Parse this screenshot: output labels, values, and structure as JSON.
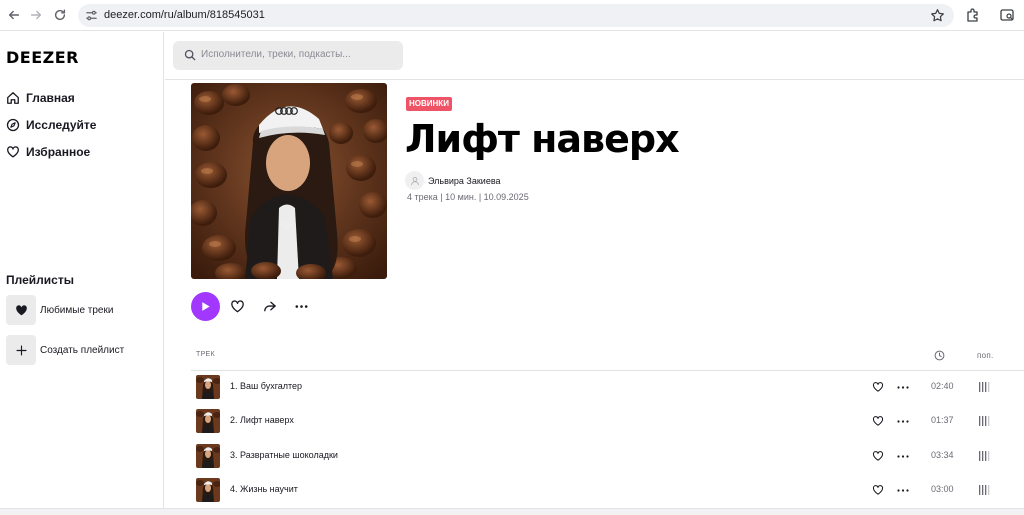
{
  "browser": {
    "url": "deezer.com/ru/album/818545031"
  },
  "sidebar": {
    "logo": "DEEZER",
    "nav": [
      {
        "label": "Главная",
        "icon": "home-icon"
      },
      {
        "label": "Исследуйте",
        "icon": "compass-icon"
      },
      {
        "label": "Избранное",
        "icon": "heart-icon"
      }
    ],
    "playlists_title": "Плейлисты",
    "playlists": [
      {
        "label": "Любимые треки",
        "icon": "heart-filled-icon"
      },
      {
        "label": "Создать плейлист",
        "icon": "plus-icon"
      }
    ]
  },
  "search": {
    "placeholder": "Исполнители, треки, подкасты..."
  },
  "album": {
    "badge": "НОВИНКИ",
    "title": "Лифт наверх",
    "artist": "Эльвира Закиева",
    "meta": "4 трека | 10 мин. | 10.09.2025"
  },
  "tracklist": {
    "col_track": "ТРЕК",
    "col_popularity": "поп.",
    "tracks": [
      {
        "title": "1. Ваш бухгалтер",
        "duration": "02:40"
      },
      {
        "title": "2. Лифт наверх",
        "duration": "01:37"
      },
      {
        "title": "3. Развратные шоколадки",
        "duration": "03:34"
      },
      {
        "title": "4. Жизнь научит",
        "duration": "03:00"
      }
    ]
  },
  "colors": {
    "accent": "#a238ff",
    "badge": "#ef5466"
  }
}
